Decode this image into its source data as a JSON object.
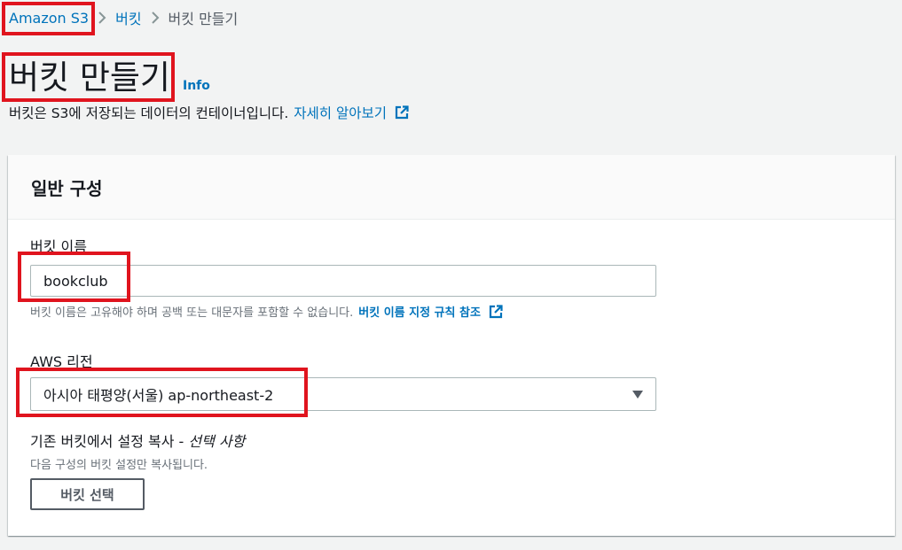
{
  "breadcrumb": {
    "items": [
      {
        "label": "Amazon S3"
      },
      {
        "label": "버킷"
      },
      {
        "label": "버킷 만들기"
      }
    ]
  },
  "header": {
    "title": "버킷 만들기",
    "info": "Info",
    "description": "버킷은 S3에 저장되는 데이터의 컨테이너입니다.",
    "learn_more": "자세히 알아보기"
  },
  "general": {
    "title": "일반 구성",
    "bucket_name": {
      "label": "버킷 이름",
      "value": "bookclub",
      "hint": "버킷 이름은 고유해야 하며 공백 또는 대문자를 포함할 수 없습니다.",
      "hint_link": "버킷 이름 지정 규칙 참조"
    },
    "region": {
      "label": "AWS 리전",
      "value": "아시아 태평양(서울) ap-northeast-2"
    },
    "copy_settings": {
      "title": "기존 버킷에서 설정 복사 -",
      "optional": "선택 사항",
      "description": "다음 구성의 버킷 설정만 복사됩니다.",
      "button": "버킷 선택"
    }
  },
  "colors": {
    "link": "#0073bb",
    "annotation": "#e0141e",
    "background": "#f2f3f3"
  }
}
